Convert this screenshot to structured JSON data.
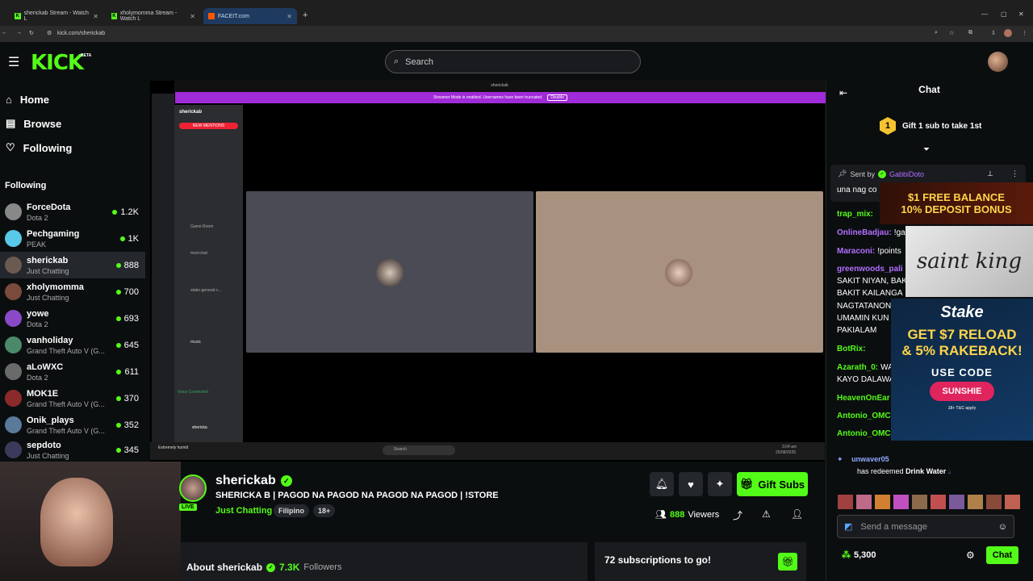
{
  "browser": {
    "tabs": [
      {
        "label": "sherickab Stream - Watch L"
      },
      {
        "label": "xholymomma Stream - Watch L"
      },
      {
        "label": "FACEIT.com"
      }
    ],
    "url": "kick.com/sherickab"
  },
  "header": {
    "logo": "KICK",
    "logo_badge": "BETA",
    "search_placeholder": "Search"
  },
  "sidebar": {
    "nav": [
      {
        "label": "Home"
      },
      {
        "label": "Browse"
      },
      {
        "label": "Following"
      }
    ],
    "following_title": "Following",
    "channels": [
      {
        "name": "ForceDota",
        "category": "Dota 2",
        "viewers": "1.2K"
      },
      {
        "name": "Pechgaming",
        "category": "PEAK",
        "viewers": "1K"
      },
      {
        "name": "sherickab",
        "category": "Just Chatting",
        "viewers": "888"
      },
      {
        "name": "xholymomma",
        "category": "Just Chatting",
        "viewers": "700"
      },
      {
        "name": "yowe",
        "category": "Dota 2",
        "viewers": "693"
      },
      {
        "name": "vanholiday",
        "category": "Grand Theft Auto V (G...",
        "viewers": "645"
      },
      {
        "name": "aLoWXC",
        "category": "Dota 2",
        "viewers": "611"
      },
      {
        "name": "MOK1E",
        "category": "Grand Theft Auto V (G...",
        "viewers": "370"
      },
      {
        "name": "Onik_plays",
        "category": "Grand Theft Auto V (G...",
        "viewers": "352"
      },
      {
        "name": "sepdoto",
        "category": "Just Chatting",
        "viewers": "345"
      }
    ]
  },
  "video": {
    "discord_title": "sherickab",
    "streamer_mode_banner": "Streamer Mode is enabled. Usernames have been truncated.",
    "disable_label": "Disable",
    "server_name": "sherickab",
    "new_mentions": "NEW MENTIONS",
    "channels": [
      "Game Room",
      "mod-chat",
      "stake-general-c...",
      "music"
    ],
    "voice_connected": "Voice Connected",
    "user_name": "shericka",
    "taskbar_search": "Search",
    "taskbar_time": "3:04 am",
    "taskbar_date": "25/08/2025",
    "taskbar_weather": "Extremely humid"
  },
  "stream": {
    "channel_name": "sherickab",
    "title": "SHERICKA B | PAGOD NA PAGOD NA PAGOD NA PAGOD | !STORE",
    "category": "Just Chatting",
    "tags": [
      "Filipino",
      "18+"
    ],
    "live_label": "LIVE",
    "gift_subs_label": "Gift Subs",
    "viewers": "888",
    "viewers_label": "Viewers",
    "about_label": "About sherickab",
    "followers": "7.3K",
    "followers_label": "Followers",
    "subs_goal": "72 subscriptions to go!"
  },
  "chat": {
    "title": "Chat",
    "gift_prompt": "Gift 1 sub to take 1st",
    "gift_badge": "1",
    "pinned_sent_by": "Sent by",
    "pinned_user": "GabbiDoto",
    "pinned_text": "una nag co",
    "messages": [
      {
        "user": "trap_mix:",
        "text": "",
        "color": "#53fc18"
      },
      {
        "user": "OnlineBadjau:",
        "text": "!ga",
        "color": "#b26eff"
      },
      {
        "user": "Maraconi:",
        "text": "!points",
        "color": "#b26eff"
      },
      {
        "user": "greenwoods_pali",
        "text": "",
        "color": "#b26eff"
      },
      {
        "user": "",
        "text": "SAKIT NIYAN, BAK",
        "color": "#fff"
      },
      {
        "user": "",
        "text": "BAKIT KAILANGA",
        "color": "#fff"
      },
      {
        "user": "",
        "text": "NAGTATANON",
        "color": "#fff"
      },
      {
        "user": "",
        "text": "UMAMIN KUN",
        "color": "#fff"
      },
      {
        "user": "",
        "text": "PAKIALAM",
        "color": "#fff"
      },
      {
        "user": "BotRix:",
        "text": "",
        "color": "#53fc18"
      },
      {
        "user": "Azarath_0:",
        "text": "WA",
        "color": "#53fc18"
      },
      {
        "user": "",
        "text": "KAYO DALAWA",
        "color": "#fff"
      },
      {
        "user": "HeavenOnEar",
        "text": "",
        "color": "#53fc18"
      },
      {
        "user": "Antonio_OMC",
        "text": "",
        "color": "#53fc18"
      },
      {
        "user": "Antonio_OMC",
        "text": "",
        "color": "#53fc18"
      }
    ],
    "redeem_user": "unwaver05",
    "redeem_text": "has redeemed",
    "redeem_item": "Drink Water",
    "input_placeholder": "Send a message",
    "points": "5,300",
    "chat_button": "Chat"
  },
  "ads": {
    "casino_line1": "$1 FREE BALANCE",
    "casino_line2": "10% DEPOSIT BONUS",
    "brand": "saint king",
    "stake_logo": "Stake",
    "stake_line1": "GET $7 RELOAD",
    "stake_line2": "& 5% RAKEBACK!",
    "code_label": "USE CODE",
    "code": "SUNSHIE",
    "tc": "18+  T&C apply"
  }
}
